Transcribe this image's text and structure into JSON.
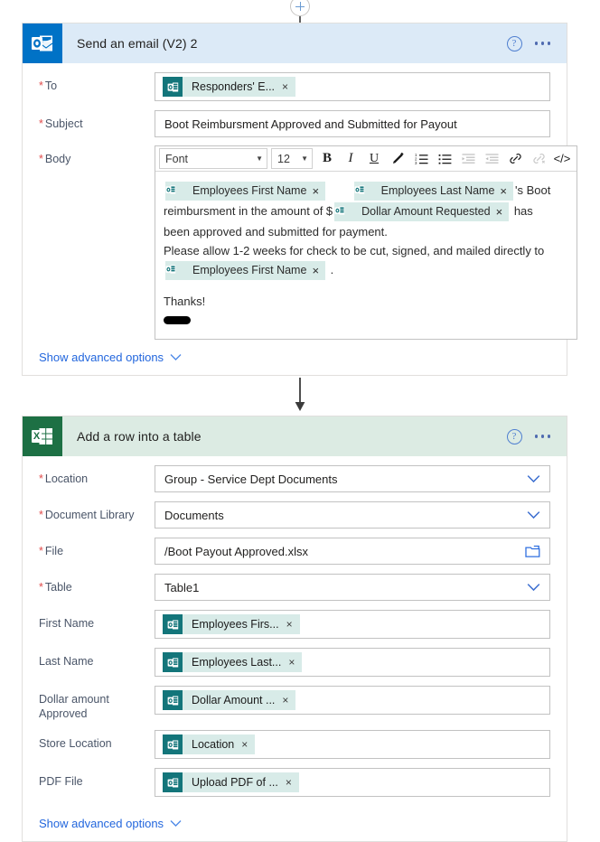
{
  "connectors": {
    "top": {
      "add_icon": "plus-circle-icon",
      "arrow_icon": "arrow-down-icon"
    },
    "middle": {
      "arrow_icon": "arrow-down-icon"
    }
  },
  "email_card": {
    "app_icon": "outlook-icon",
    "title": "Send an email (V2) 2",
    "help_icon": "?",
    "menu_icon": "ellipsis-icon",
    "fields": {
      "to": {
        "label": "To",
        "required": true,
        "tokens": [
          {
            "icon": "outlook-token-icon",
            "label": "Responders' E...",
            "remove": "×"
          }
        ]
      },
      "subject": {
        "label": "Subject",
        "required": true,
        "value": "Boot Reimbursment Approved and Submitted for Payout"
      },
      "body": {
        "label": "Body",
        "required": true,
        "toolbar": {
          "font_label": "Font",
          "size_label": "12",
          "bold": "B",
          "italic": "I",
          "underline": "U",
          "pen": "pen-icon",
          "numbered_list": "numbered-list-icon",
          "bullet_list": "bullet-list-icon",
          "indent_decrease": "indent-decrease-icon",
          "indent_increase": "indent-increase-icon",
          "link": "link-icon",
          "unlink": "unlink-icon",
          "code": "</>"
        },
        "content": {
          "token_first_name": "Employees First Name",
          "token_last_name": "Employees Last Name",
          "token_dollar_amount": "Dollar Amount Requested",
          "text_after_lastname": "'s Boot",
          "text_reimbursement": "reimbursment in the amount of $",
          "text_has": "has",
          "text_approved": "been approved and submitted for payment.",
          "text_allow": "Please allow 1-2 weeks for check to be cut, signed, and mailed directly to",
          "token_first_name_2": "Employees First Name",
          "text_period": ".",
          "text_thanks": "Thanks!",
          "signature_redacted": "redacted-signature"
        }
      }
    },
    "advanced_options": {
      "label": "Show advanced options",
      "chevron": "chevron-down-icon"
    }
  },
  "excel_card": {
    "app_icon": "excel-icon",
    "title": "Add a row into a table",
    "help_icon": "?",
    "menu_icon": "ellipsis-icon",
    "fields": [
      {
        "label": "Location",
        "required": true,
        "type": "dropdown",
        "value": "Group - Service Dept Documents"
      },
      {
        "label": "Document Library",
        "required": true,
        "type": "dropdown",
        "value": "Documents"
      },
      {
        "label": "File",
        "required": true,
        "type": "file",
        "value": "/Boot Payout Approved.xlsx",
        "icon": "folder-icon"
      },
      {
        "label": "Table",
        "required": true,
        "type": "dropdown",
        "value": "Table1"
      },
      {
        "label": "First Name",
        "required": false,
        "type": "token",
        "token": "Employees Firs...",
        "remove": "×"
      },
      {
        "label": "Last Name",
        "required": false,
        "type": "token",
        "token": "Employees Last...",
        "remove": "×"
      },
      {
        "label": "Dollar amount Approved",
        "required": false,
        "type": "token",
        "token": "Dollar Amount ...",
        "remove": "×"
      },
      {
        "label": "Store Location",
        "required": false,
        "type": "token",
        "token": "Location",
        "remove": "×"
      },
      {
        "label": "PDF File",
        "required": false,
        "type": "token",
        "token": "Upload PDF of ...",
        "remove": "×"
      }
    ],
    "advanced_options": {
      "label": "Show advanced options",
      "chevron": "chevron-down-icon"
    }
  },
  "colors": {
    "outlook_header": "#dceaf7",
    "outlook_icon": "#0072c6",
    "excel_header": "#dcebe3",
    "excel_icon": "#1d7044",
    "token_bg": "#d8ebe8",
    "token_icon": "#13757a",
    "link": "#2266dd",
    "required_asterisk": "#e04b4b"
  }
}
